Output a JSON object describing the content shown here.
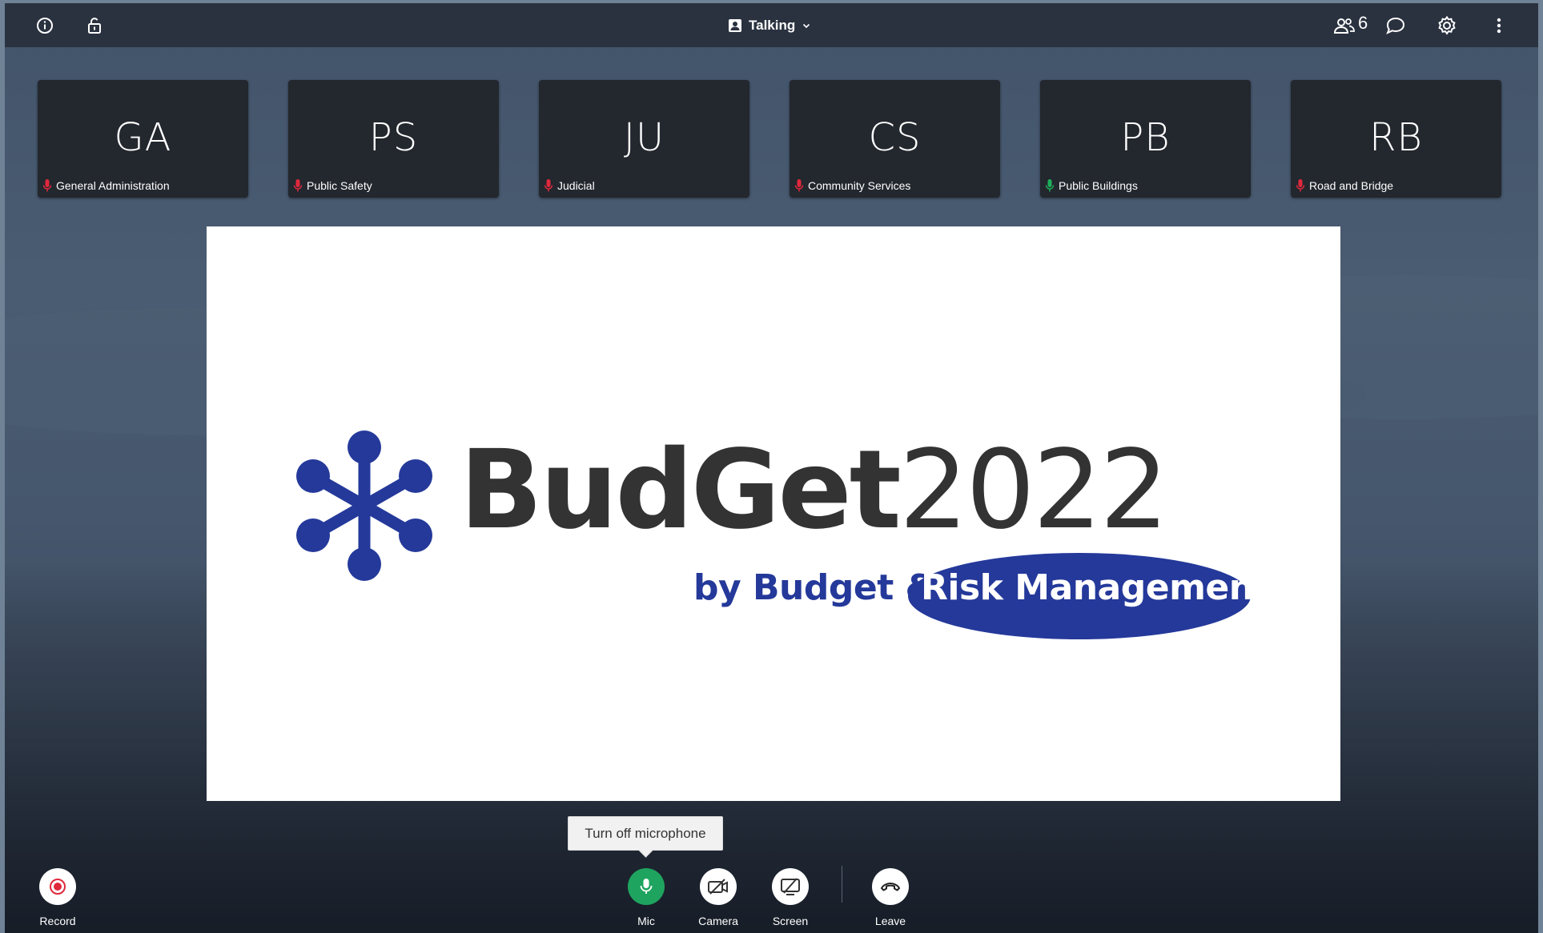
{
  "header": {
    "status_label": "Talking",
    "participant_count": "6"
  },
  "participants": [
    {
      "initials": "GA",
      "name": "General Administration",
      "mic": "muted"
    },
    {
      "initials": "PS",
      "name": "Public Safety",
      "mic": "muted"
    },
    {
      "initials": "JU",
      "name": "Judicial",
      "mic": "muted"
    },
    {
      "initials": "CS",
      "name": "Community Services",
      "mic": "muted"
    },
    {
      "initials": "PB",
      "name": "Public Buildings",
      "mic": "active"
    },
    {
      "initials": "RB",
      "name": "Road and Bridge",
      "mic": "muted"
    }
  ],
  "shared_screen": {
    "brand_bold": "BudGet",
    "brand_year": "2022",
    "tagline_prefix": "by Budget &",
    "tagline_highlight": "Risk Management",
    "brand_color": "#24399a"
  },
  "tooltip": "Turn off microphone",
  "controls": {
    "record": "Record",
    "mic": "Mic",
    "camera": "Camera",
    "screen": "Screen",
    "leave": "Leave"
  },
  "colors": {
    "mic_muted": "#e0283c",
    "mic_active": "#1fae5a",
    "mic_button": "#1fa45f",
    "record": "#e0283c"
  }
}
